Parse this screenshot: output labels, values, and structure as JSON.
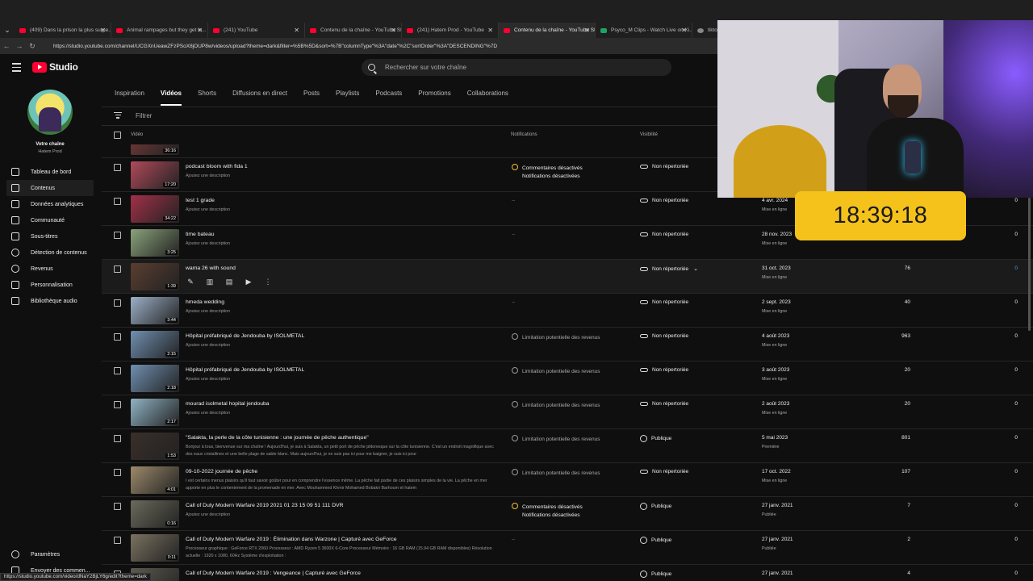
{
  "browser": {
    "tabs": [
      {
        "label": "(409) Dans la prison la plus surpe...",
        "fav": "red",
        "active": false
      },
      {
        "label": "Animal rampages but they get in...",
        "fav": "red",
        "active": false
      },
      {
        "label": "(241) YouTube",
        "fav": "red",
        "active": false
      },
      {
        "label": "Contenu de la chaîne - YouTube St...",
        "fav": "red",
        "active": false
      },
      {
        "label": "(241) Hatem Prod - YouTube",
        "fav": "red",
        "active": false
      },
      {
        "label": "Contenu de la chaîne - YouTube St...",
        "fav": "red",
        "active": true
      },
      {
        "label": "Psyco_M Clips - Watch Live on Ki...",
        "fav": "green",
        "active": false
      },
      {
        "label": "tiktok",
        "fav": "grey",
        "active": false
      }
    ],
    "url": "https://studio.youtube.com/channel/UCGXnUeawZFzPSoX8jOUP8w/videos/upload?theme=dark&filter=%5B%5D&sort=%7B\"columnType\"%3A\"date\"%2C\"sortOrder\"%3A\"DESCENDING\"%7D",
    "status_url": "https://studio.youtube.com/video/dNaY2BjLY6g/edit?theme=dark"
  },
  "header": {
    "logo_text": "Studio",
    "search_placeholder": "Rechercher sur votre chaîne"
  },
  "channel": {
    "title": "Votre chaîne",
    "name": "Hatem Prod"
  },
  "sidebar": {
    "items": [
      {
        "label": "Tableau de bord",
        "icon": "dashboard-icon",
        "active": false
      },
      {
        "label": "Contenus",
        "icon": "content-icon",
        "active": true
      },
      {
        "label": "Données analytiques",
        "icon": "analytics-icon",
        "active": false
      },
      {
        "label": "Communauté",
        "icon": "community-icon",
        "active": false
      },
      {
        "label": "Sous-titres",
        "icon": "subtitles-icon",
        "active": false
      },
      {
        "label": "Détection de contenus",
        "icon": "copyright-icon",
        "active": false
      },
      {
        "label": "Revenus",
        "icon": "dollar-icon",
        "active": false
      },
      {
        "label": "Personnalisation",
        "icon": "customization-icon",
        "active": false
      },
      {
        "label": "Bibliothèque audio",
        "icon": "audio-library-icon",
        "active": false
      }
    ],
    "bottom": [
      {
        "label": "Paramètres",
        "icon": "gear-icon"
      },
      {
        "label": "Envoyer des commen...",
        "icon": "feedback-icon"
      }
    ]
  },
  "content_tabs": [
    "Inspiration",
    "Vidéos",
    "Shorts",
    "Diffusions en direct",
    "Posts",
    "Playlists",
    "Podcasts",
    "Promotions",
    "Collaborations"
  ],
  "active_tab": "Vidéos",
  "filter_label": "Filtrer",
  "table": {
    "headers": {
      "video": "Vidéo",
      "notifications": "Notifications",
      "visibility": "Visibilité"
    },
    "rows": [
      {
        "title": "",
        "desc": "",
        "duration": "36:16",
        "notif": [],
        "visibility": "",
        "date": "",
        "date_status": "",
        "views": "",
        "comments": "",
        "thumb": "#7a3a3a"
      },
      {
        "title": "podcast bloom with fida 1",
        "desc": "Ajoutez une description",
        "duration": "17:20",
        "notif_type": "warn",
        "notif": [
          "Commentaires désactivés",
          "Notifications désactivées"
        ],
        "visibility": "Non répertoriée",
        "vis_icon": "link",
        "date": "",
        "date_status": "",
        "views": "",
        "comments": "",
        "thumb": "#b04a5a"
      },
      {
        "title": "test 1 grade",
        "desc": "Ajoutez une description",
        "duration": "34:22",
        "notif_type": "none",
        "notif": [
          "--"
        ],
        "visibility": "Non répertoriée",
        "vis_icon": "link",
        "date": "4 avr. 2024",
        "date_status": "Mise en ligne",
        "views": "",
        "comments": "0",
        "thumb": "#a23048"
      },
      {
        "title": "time bateau",
        "desc": "Ajoutez une description",
        "duration": "3:25",
        "notif_type": "none",
        "notif": [
          "--"
        ],
        "visibility": "Non répertoriée",
        "vis_icon": "link",
        "date": "28 nov. 2023",
        "date_status": "Mise en ligne",
        "views": "",
        "comments": "0",
        "thumb": "#8aa27a"
      },
      {
        "title": "wama 26 with sound",
        "desc": "",
        "duration": "1:39",
        "notif_type": "none",
        "notif": [],
        "visibility": "Non répertoriée",
        "vis_icon": "link",
        "vis_chevron": true,
        "date": "31 oct. 2023",
        "date_status": "Mise en ligne",
        "views": "76",
        "comments": "0",
        "comments_blue": true,
        "hover": true,
        "thumb": "#5a3e30"
      },
      {
        "title": "hmeda wedding",
        "desc": "Ajoutez une description",
        "duration": "3:44",
        "notif_type": "none",
        "notif": [
          "--"
        ],
        "visibility": "Non répertoriée",
        "vis_icon": "link",
        "date": "2 sept. 2023",
        "date_status": "Mise en ligne",
        "views": "40",
        "comments": "0",
        "thumb": "#9cb0c8"
      },
      {
        "title": "Hôpital préfabriqué de Jendouba by ISOLMETAL",
        "desc": "Ajoutez une description",
        "duration": "2:15",
        "notif_type": "info",
        "notif": [
          "Limitation potentielle des revenus"
        ],
        "visibility": "Non répertoriée",
        "vis_icon": "link",
        "date": "4 août 2023",
        "date_status": "Mise en ligne",
        "views": "963",
        "comments": "0",
        "thumb": "#6f8fb0"
      },
      {
        "title": "Hôpital préfabriqué de Jendouba by ISOLMETAL",
        "desc": "Ajoutez une description",
        "duration": "2:18",
        "notif_type": "info",
        "notif": [
          "Limitation potentielle des revenus"
        ],
        "visibility": "Non répertoriée",
        "vis_icon": "link",
        "date": "3 août 2023",
        "date_status": "Mise en ligne",
        "views": "20",
        "comments": "0",
        "thumb": "#6f8fb0"
      },
      {
        "title": "mourad isolmetal hopital jendouba",
        "desc": "Ajoutez une description",
        "duration": "2:17",
        "notif_type": "info",
        "notif": [
          "Limitation potentielle des revenus"
        ],
        "visibility": "Non répertoriée",
        "vis_icon": "link",
        "date": "2 août 2023",
        "date_status": "Mise en ligne",
        "views": "20",
        "comments": "0",
        "thumb": "#8fb3c4"
      },
      {
        "title": "\"Salakta, la perle de la côte tunisienne : une journée de pêche authentique\"",
        "desc": "Bonjour à tous, bienvenue sur ma chaîne ! Aujourd'hui, je suis à Salakta, un petit port de pêche pittoresque sur la côte tunisienne. C'est un endroit magnifique avec des eaux cristallines et une belle plage de sable blanc. Mais aujourd'hui, je ne suis pas ici pour me baigner, je suis ici pour",
        "duration": "1:53",
        "notif_type": "info",
        "notif": [
          "Limitation potentielle des revenus"
        ],
        "visibility": "Publique",
        "vis_icon": "globe",
        "date": "5 mai 2023",
        "date_status": "Première",
        "views": "801",
        "comments": "0",
        "thumb": "#3a2f2a"
      },
      {
        "title": "09-10-2022 journée de pêche",
        "desc": "I est certains menus plaisirs qu'il faut savoir goûter pour en comprendre l'essence même. La pêche fait partie de ces plaisirs simples de la vie. La pêche en mer apporte en plus le contentement de la promenade en mer. Avec Mouhammed Khmir Mohamed Bobakri Barhoum et hatem",
        "duration": "4:01",
        "notif_type": "info",
        "notif": [
          "Limitation potentielle des revenus"
        ],
        "visibility": "Non répertoriée",
        "vis_icon": "link",
        "date": "17 oct. 2022",
        "date_status": "Mise en ligne",
        "views": "107",
        "comments": "0",
        "thumb": "#9c8a6a"
      },
      {
        "title": "Call of Duty Modern Warfare 2019 2021 01 23 15 09 51 111 DVR",
        "desc": "Ajoutez une description",
        "duration": "0:16",
        "notif_type": "warn",
        "notif": [
          "Commentaires désactivés",
          "Notifications désactivées"
        ],
        "visibility": "Publique",
        "vis_icon": "globe",
        "date": "27 janv. 2021",
        "date_status": "Publiée",
        "views": "7",
        "comments": "0",
        "thumb": "#6b6a5c"
      },
      {
        "title": "Call of Duty Modern Warfare 2019 : Élimination dans Warzone | Capturé avec GeForce",
        "desc": "Processeur graphique : GeForce RTX 2060 Processeur : AMD Ryzen 5 3600X 6-Core Processeur Mémoire : 16 GB RAM (15.94 GB RAM disponibles) Résolution actuelle : 1920 x 1080, 60Hz Système d'exploitation :",
        "duration": "0:11",
        "notif_type": "none",
        "notif": [
          "--"
        ],
        "visibility": "Publique",
        "vis_icon": "globe",
        "date": "27 janv. 2021",
        "date_status": "Publiée",
        "views": "2",
        "comments": "0",
        "thumb": "#7a7260"
      },
      {
        "title": "Call of Duty Modern Warfare 2019 : Vengeance | Capturé avec GeForce",
        "desc": "",
        "duration": "",
        "notif_type": "none",
        "notif": [],
        "visibility": "Publique",
        "vis_icon": "globe",
        "date": "27 janv. 2021",
        "date_status": "",
        "views": "4",
        "comments": "0",
        "thumb": "#5d5a4e"
      }
    ]
  },
  "overlay": {
    "clock": "18:39:18"
  }
}
